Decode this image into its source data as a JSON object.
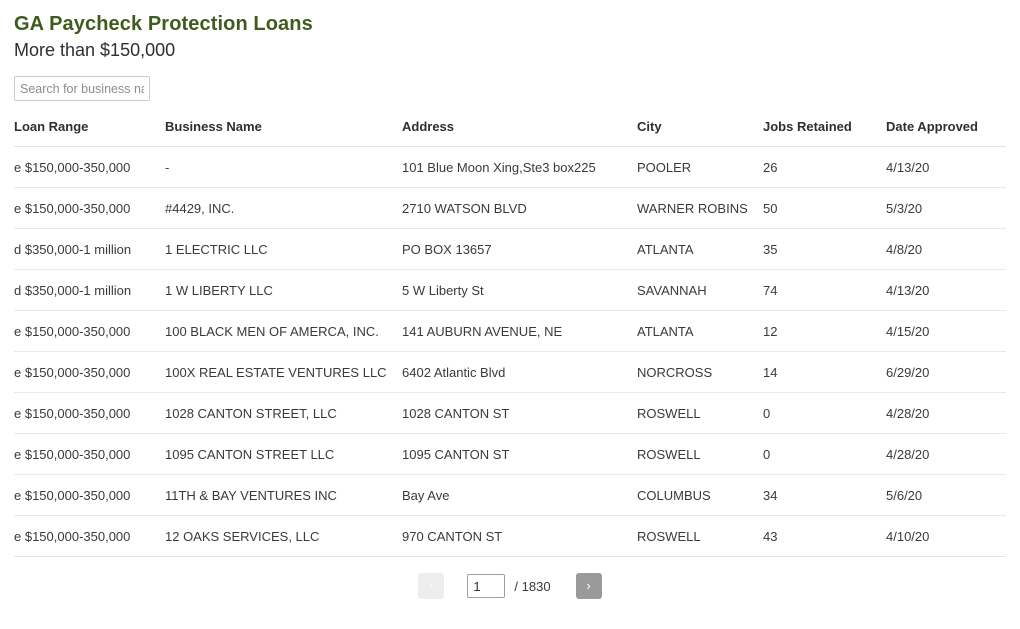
{
  "header": {
    "title": "GA Paycheck Protection Loans",
    "subtitle": "More than $150,000",
    "title_color": "#3f5c1d"
  },
  "search": {
    "placeholder": "Search for business name",
    "value": ""
  },
  "table": {
    "columns": [
      "Loan Range",
      "Business Name",
      "Address",
      "City",
      "Jobs Retained",
      "Date Approved"
    ],
    "rows": [
      {
        "loan_range": "e $150,000-350,000",
        "business_name": "-",
        "address": "101 Blue Moon Xing,Ste3 box225",
        "city": "POOLER",
        "jobs_retained": "26",
        "date_approved": "4/13/20"
      },
      {
        "loan_range": "e $150,000-350,000",
        "business_name": "#4429, INC.",
        "address": "2710 WATSON BLVD",
        "city": "WARNER ROBINS",
        "jobs_retained": "50",
        "date_approved": "5/3/20"
      },
      {
        "loan_range": "d $350,000-1 million",
        "business_name": "1 ELECTRIC LLC",
        "address": "PO BOX 13657",
        "city": "ATLANTA",
        "jobs_retained": "35",
        "date_approved": "4/8/20"
      },
      {
        "loan_range": "d $350,000-1 million",
        "business_name": "1 W LIBERTY LLC",
        "address": "5 W Liberty St",
        "city": "SAVANNAH",
        "jobs_retained": "74",
        "date_approved": "4/13/20"
      },
      {
        "loan_range": "e $150,000-350,000",
        "business_name": "100 BLACK MEN OF AMERCA, INC.",
        "address": "141 AUBURN AVENUE, NE",
        "city": "ATLANTA",
        "jobs_retained": "12",
        "date_approved": "4/15/20"
      },
      {
        "loan_range": "e $150,000-350,000",
        "business_name": "100X REAL ESTATE VENTURES LLC",
        "address": "6402 Atlantic Blvd",
        "city": "NORCROSS",
        "jobs_retained": "14",
        "date_approved": "6/29/20"
      },
      {
        "loan_range": "e $150,000-350,000",
        "business_name": "1028 CANTON STREET, LLC",
        "address": "1028 CANTON ST",
        "city": "ROSWELL",
        "jobs_retained": "0",
        "date_approved": "4/28/20"
      },
      {
        "loan_range": "e $150,000-350,000",
        "business_name": "1095 CANTON STREET LLC",
        "address": "1095 CANTON ST",
        "city": "ROSWELL",
        "jobs_retained": "0",
        "date_approved": "4/28/20"
      },
      {
        "loan_range": "e $150,000-350,000",
        "business_name": "11TH & BAY VENTURES INC",
        "address": "Bay Ave",
        "city": "COLUMBUS",
        "jobs_retained": "34",
        "date_approved": "5/6/20"
      },
      {
        "loan_range": "e $150,000-350,000",
        "business_name": "12 OAKS SERVICES, LLC",
        "address": "970 CANTON ST",
        "city": "ROSWELL",
        "jobs_retained": "43",
        "date_approved": "4/10/20"
      }
    ]
  },
  "pagination": {
    "prev_label": "‹",
    "next_label": "›",
    "current_page": "1",
    "total_pages_label": "/ 1830",
    "total_pages": 1830,
    "prev_disabled": true
  }
}
